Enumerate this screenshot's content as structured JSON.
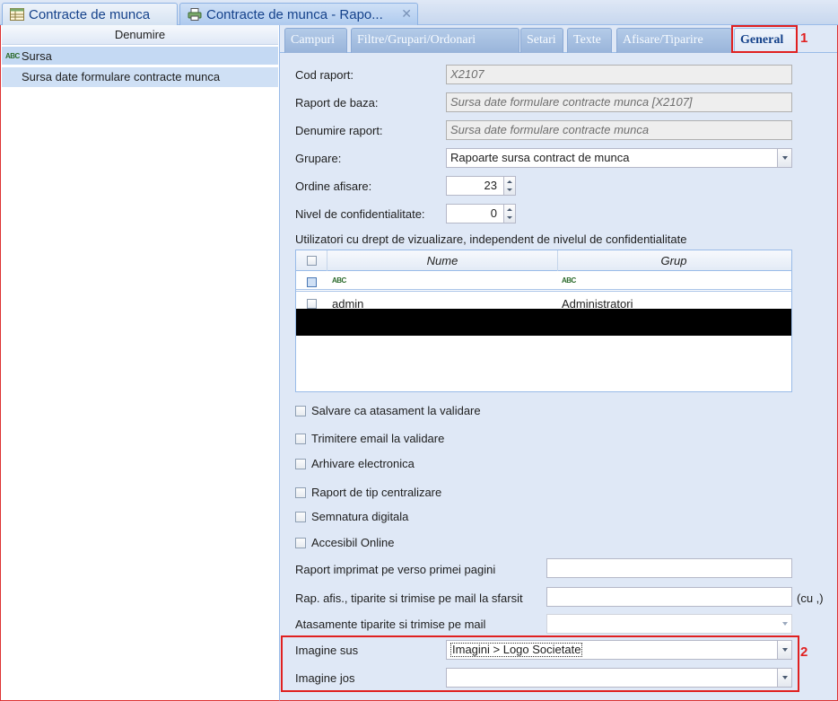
{
  "doc_tabs": [
    {
      "label": "Contracte de munca",
      "icon": "table-icon"
    },
    {
      "label": "Contracte de munca - Rapo...",
      "icon": "printer-icon"
    }
  ],
  "left_panel": {
    "column_header": "Denumire",
    "group": {
      "label": "Sursa"
    },
    "items": [
      {
        "label": "Sursa date formulare contracte munca"
      }
    ]
  },
  "report_tabs": [
    {
      "label": "Campuri"
    },
    {
      "label": "Filtre/Grupari/Ordonari"
    },
    {
      "label": "Setari"
    },
    {
      "label": "Texte"
    },
    {
      "label": "Afisare/Tiparire"
    },
    {
      "label": "General"
    }
  ],
  "annotations": {
    "tab_marker": "1",
    "images_marker": "2"
  },
  "form": {
    "cod_raport": {
      "label": "Cod raport:",
      "value": "X2107"
    },
    "raport_baza": {
      "label": "Raport de baza:",
      "value": "Sursa date formulare contracte munca [X2107]"
    },
    "denumire_raport": {
      "label": "Denumire raport:",
      "value": "Sursa date formulare contracte munca"
    },
    "grupare": {
      "label": "Grupare:",
      "value": "Rapoarte sursa contract de munca"
    },
    "ordine_afisare": {
      "label": "Ordine afisare:",
      "value": "23"
    },
    "nivel_conf": {
      "label": "Nivel de confidentialitate:",
      "value": "0"
    },
    "users_label": "Utilizatori cu drept de vizualizare, independent de nivelul de confidentialitate"
  },
  "grid": {
    "columns": [
      "Nume",
      "Grup"
    ],
    "rows": [
      {
        "nume": "admin",
        "grup": "Administratori"
      }
    ]
  },
  "checkboxes": [
    {
      "label": "Salvare ca atasament la validare",
      "checked": false
    },
    {
      "label": "Trimitere email la validare",
      "checked": false
    },
    {
      "label": "Arhivare electronica",
      "checked": false
    },
    {
      "label": "Raport de tip centralizare",
      "checked": false
    },
    {
      "label": "Semnatura digitala",
      "checked": false
    },
    {
      "label": "Accesibil Online",
      "checked": false
    }
  ],
  "lower_form": {
    "verso": {
      "label": "Raport imprimat pe verso primei pagini",
      "value": ""
    },
    "sfarsit": {
      "label": "Rap. afis., tiparite si trimise pe mail la sfarsit",
      "value": "",
      "hint": "(cu ,)"
    },
    "atasamente": {
      "label": "Atasamente tiparite si trimise pe mail",
      "value": ""
    },
    "imagine_sus": {
      "label": "Imagine sus",
      "value": "Imagini > Logo Societate"
    },
    "imagine_jos": {
      "label": "Imagine jos",
      "value": ""
    }
  },
  "colors": {
    "accent": "#15428b",
    "highlight": "#e02020",
    "panel_bg": "#dfe8f6"
  }
}
